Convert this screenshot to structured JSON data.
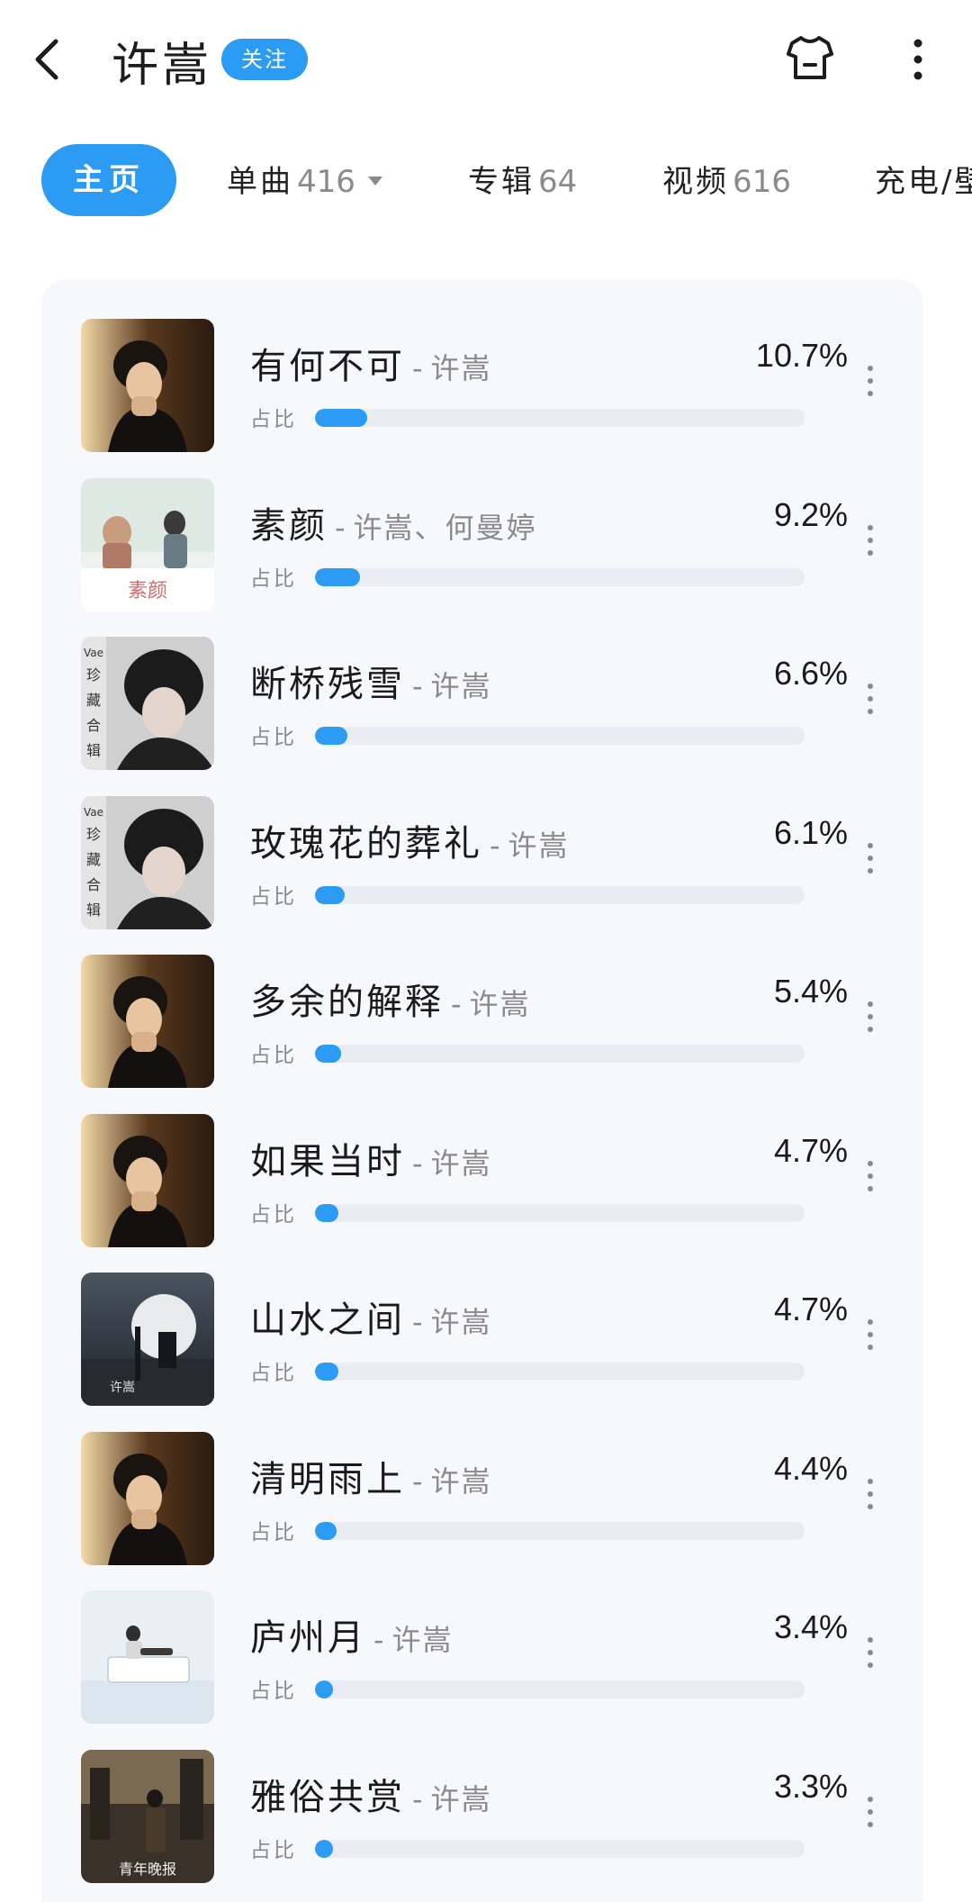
{
  "header": {
    "title": "许嵩",
    "follow_label": "关注"
  },
  "tabs": [
    {
      "label": "主页",
      "count": ""
    },
    {
      "label": "单曲",
      "count": "416"
    },
    {
      "label": "专辑",
      "count": "64"
    },
    {
      "label": "视频",
      "count": "616"
    },
    {
      "label": "充电/壁",
      "count": ""
    }
  ],
  "share_label": "占比",
  "songs": [
    {
      "title": "有何不可",
      "artist": "许嵩",
      "percent": "10.7%",
      "share": 0.107,
      "cover": "portrait"
    },
    {
      "title": "素颜",
      "artist": "许嵩、何曼婷",
      "percent": "9.2%",
      "share": 0.092,
      "cover": "suyan",
      "cover_text": "素颜"
    },
    {
      "title": "断桥残雪",
      "artist": "许嵩",
      "percent": "6.6%",
      "share": 0.066,
      "cover": "vae",
      "cover_text": "Vae珍藏合辑"
    },
    {
      "title": "玫瑰花的葬礼",
      "artist": "许嵩",
      "percent": "6.1%",
      "share": 0.061,
      "cover": "vae",
      "cover_text": "Vae珍藏合辑"
    },
    {
      "title": "多余的解释",
      "artist": "许嵩",
      "percent": "5.4%",
      "share": 0.054,
      "cover": "portrait"
    },
    {
      "title": "如果当时",
      "artist": "许嵩",
      "percent": "4.7%",
      "share": 0.047,
      "cover": "portrait"
    },
    {
      "title": "山水之间",
      "artist": "许嵩",
      "percent": "4.7%",
      "share": 0.047,
      "cover": "moon",
      "cover_text": "许嵩"
    },
    {
      "title": "清明雨上",
      "artist": "许嵩",
      "percent": "4.4%",
      "share": 0.044,
      "cover": "portrait"
    },
    {
      "title": "庐州月",
      "artist": "许嵩",
      "percent": "3.4%",
      "share": 0.034,
      "cover": "piano"
    },
    {
      "title": "雅俗共赏",
      "artist": "许嵩",
      "percent": "3.3%",
      "share": 0.033,
      "cover": "city",
      "cover_text": "青年晚报"
    }
  ],
  "colors": {
    "accent": "#2b9bf4",
    "track": "#e9edf3",
    "card_bg": "#f6f8fb",
    "muted": "#8a8a8a"
  },
  "icons": {
    "back": "chevron-left-icon",
    "shirt": "tshirt-icon",
    "more": "more-vertical-icon"
  }
}
